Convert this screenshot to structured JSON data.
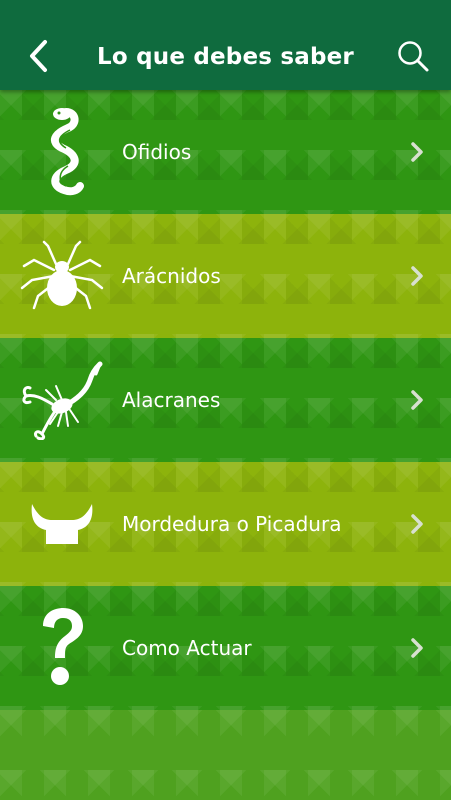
{
  "header": {
    "title": "Lo que debes saber",
    "back_icon": "chevron-left-icon",
    "search_icon": "search-icon"
  },
  "menu": {
    "items": [
      {
        "label": "Ofidios",
        "icon": "snake-icon"
      },
      {
        "label": "Arácnidos",
        "icon": "spider-icon"
      },
      {
        "label": "Alacranes",
        "icon": "scorpion-icon"
      },
      {
        "label": "Mordedura o Picadura",
        "icon": "fangs-icon"
      },
      {
        "label": "Como Actuar",
        "icon": "question-mark-icon"
      }
    ]
  },
  "colors": {
    "header": "#0f6b3e",
    "row_dark": "#2f9613",
    "row_light": "#8db30c",
    "chevron": "#d8e0d0"
  }
}
